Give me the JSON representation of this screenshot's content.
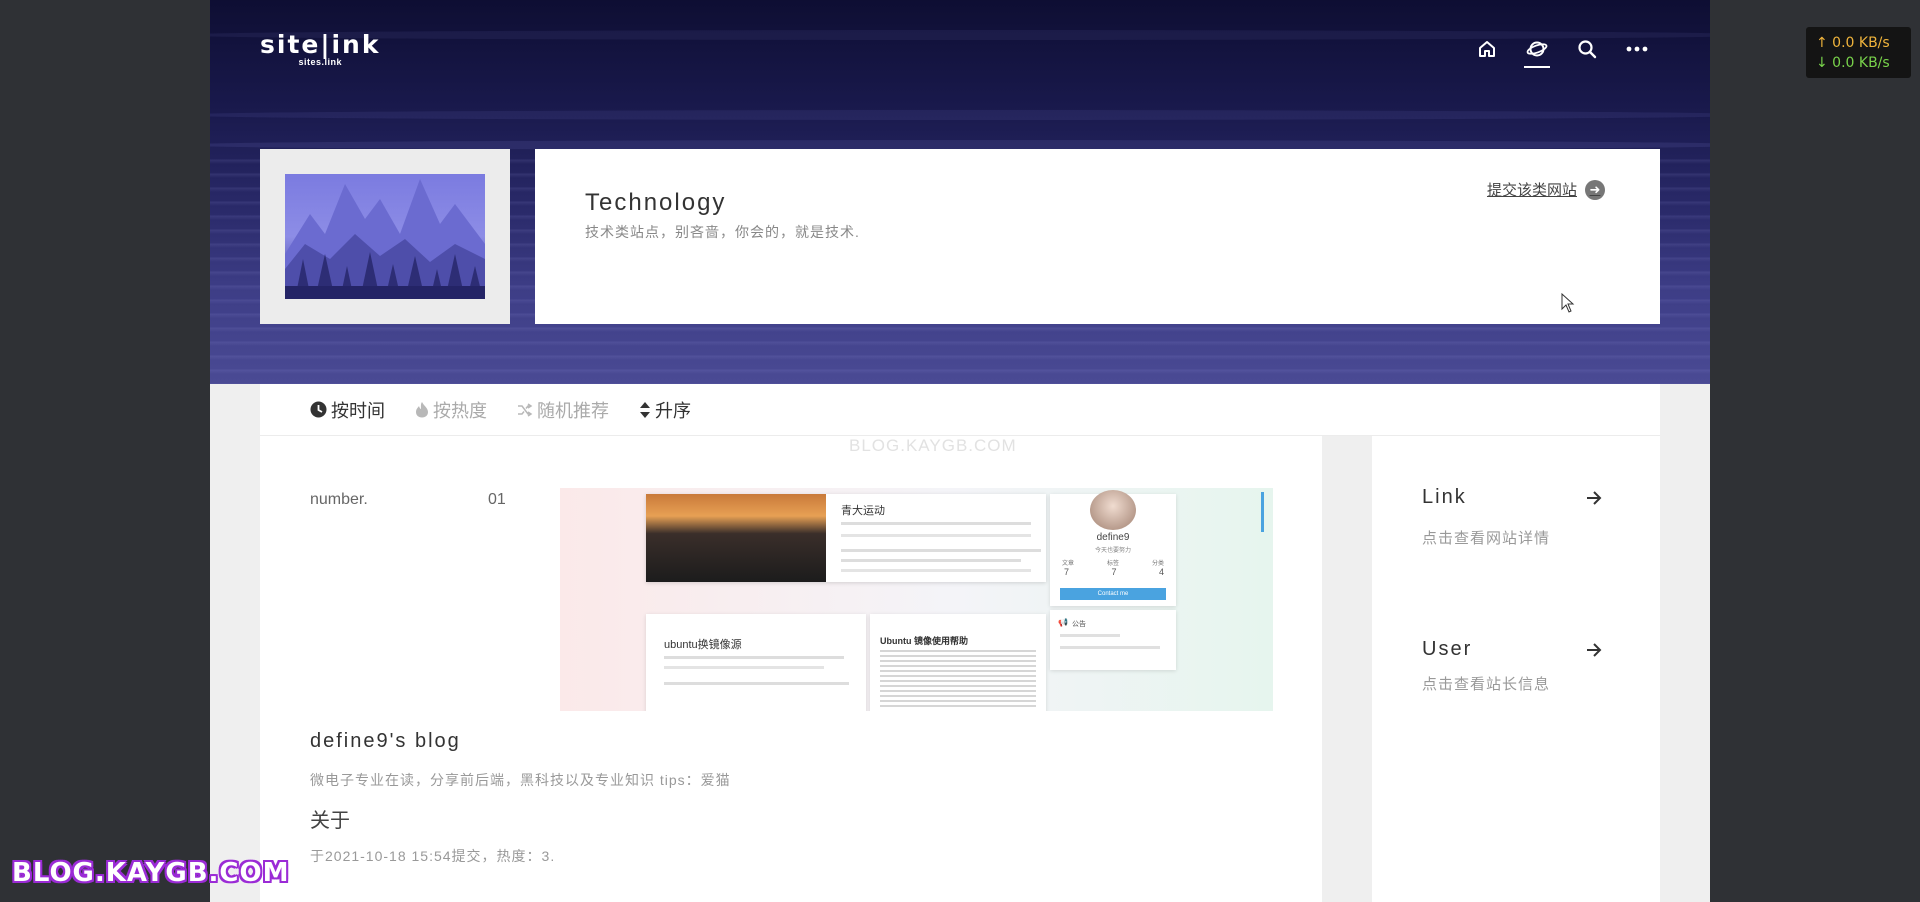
{
  "logo": {
    "main": "site|ink",
    "sub": "sites.link"
  },
  "nav": {
    "items": [
      "home-icon",
      "planet-icon",
      "search-icon",
      "more-icon"
    ],
    "active": "planet-icon"
  },
  "category": {
    "title": "Technology",
    "description": "技术类站点，别吝啬，你会的，就是技术.",
    "submit_label": "提交该类网站"
  },
  "sort": {
    "by_time": "按时间",
    "by_heat": "按热度",
    "random": "随机推荐",
    "order": "升序",
    "active": "by_time"
  },
  "post": {
    "number_label": "number.",
    "number_value": "01",
    "site_title": "define9's blog",
    "site_desc": "微电子专业在读，分享前后端，黑科技以及专业知识 tips：爱猫",
    "about": "关于",
    "meta": "于2021-10-18 15:54提交，热度：3."
  },
  "screenshot": {
    "card1_title": "青大运动",
    "card2_title": "ubuntu换镜像源",
    "card3_title": "Ubuntu 镜像使用帮助",
    "author_name": "define9",
    "author_tagline": "今天也要努力",
    "stat_labels": [
      "文章",
      "标签",
      "分类"
    ],
    "stat_values": [
      "7",
      "7",
      "4"
    ],
    "contact_label": "Contact me",
    "notice_label": "公告"
  },
  "sidebar": {
    "link_title": "Link",
    "link_desc": "点击查看网站详情",
    "user_title": "User",
    "user_desc": "点击查看站长信息"
  },
  "netspeed": {
    "up": "↑ 0.0 KB/s",
    "down": "↓ 0.0 KB/s"
  },
  "watermark": {
    "top": "BLOG.KAYGB.COM",
    "bottom": "BLOG.KAYGB.COM"
  },
  "colors": {
    "accent_purple": "#9b2bd6",
    "hero_dark": "#0e0e33",
    "speed_up": "#f0b43c",
    "speed_down": "#79d34b"
  }
}
